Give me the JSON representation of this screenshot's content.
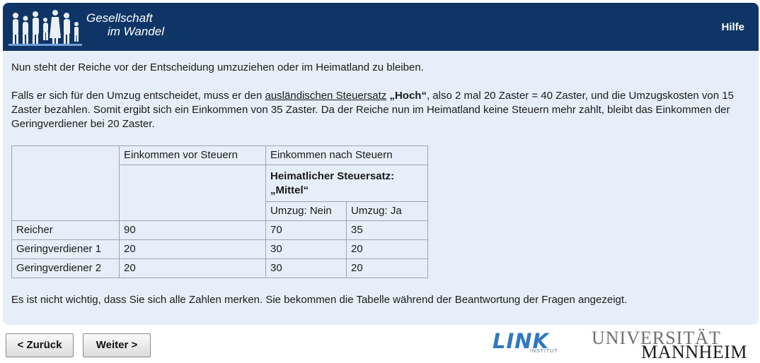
{
  "header": {
    "logo_line1": "Gesellschaft",
    "logo_line2": "im Wandel",
    "help_label": "Hilfe",
    "colors": {
      "header_bg": "#0e3566",
      "content_bg": "#e6eff9"
    }
  },
  "content": {
    "para1": "Nun steht der Reiche vor der Entscheidung umzuziehen oder im Heimatland zu bleiben.",
    "para2_part1": "Falls er sich für den Umzug entscheidet, muss er den ",
    "para2_link": "ausländischen Steuersatz",
    "para2_part2": " ",
    "para2_bold": "„Hoch“",
    "para2_part3": ", also 2 mal 20 Zaster = 40 Zaster, und die Umzugskosten von 15 Zaster bezahlen. Somit ergibt sich ein Einkommen von 35 Zaster. Da der Reiche nun im Heimatland keine Steuern mehr zahlt, bleibt das Einkommen der Geringverdiener bei 20 Zaster.",
    "para3": "Es ist nicht wichtig, dass Sie sich alle Zahlen merken. Sie bekommen die Tabelle während der Beantwortung der Fragen angezeigt."
  },
  "table": {
    "header_before_tax": "Einkommen vor Steuern",
    "header_after_tax": "Einkommen nach Steuern",
    "subheader_rate": "Heimatlicher Steuersatz: „Mittel“",
    "col_move_no": "Umzug: Nein",
    "col_move_yes": "Umzug: Ja",
    "rows": [
      {
        "label": "Reicher",
        "before": "90",
        "move_no": "70",
        "move_yes": "35"
      },
      {
        "label": "Geringverdiener 1",
        "before": "20",
        "move_no": "30",
        "move_yes": "20"
      },
      {
        "label": "Geringverdiener 2",
        "before": "20",
        "move_no": "30",
        "move_yes": "20"
      }
    ]
  },
  "nav": {
    "back_label": "< Zurück",
    "next_label": "Weiter >"
  },
  "footer_logos": {
    "link_word": "LINK",
    "link_sub": "INSTITUT",
    "uni_top": "UNIVERSITÄT",
    "uni_bottom": "MANNHEIM"
  }
}
